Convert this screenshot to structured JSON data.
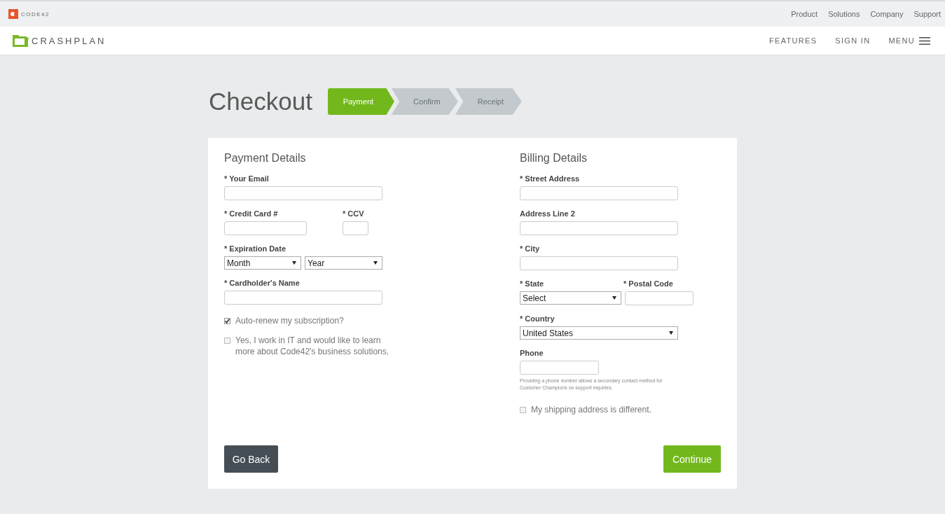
{
  "top_bar": {
    "brand": "CODE42",
    "links": [
      "Product",
      "Solutions",
      "Company",
      "Support"
    ]
  },
  "nav": {
    "brand": "CRASHPLAN",
    "links": [
      "FEATURES",
      "SIGN IN"
    ],
    "menu": "MENU"
  },
  "title": "Checkout",
  "steps": [
    {
      "label": "Payment",
      "selected": true
    },
    {
      "label": "Confirm",
      "selected": false
    },
    {
      "label": "Receipt",
      "selected": false
    }
  ],
  "payment": {
    "heading": "Payment Details",
    "email": {
      "label": "* Your Email"
    },
    "card_number": {
      "label": "* Credit Card #"
    },
    "ccv": {
      "label": "* CCV"
    },
    "expiration": {
      "label": "* Expiration Date",
      "month": "Month",
      "year": "Year"
    },
    "cardholder": {
      "label": "* Cardholder's Name"
    },
    "options": [
      {
        "label": "Auto-renew my subscription?",
        "checked": true
      },
      {
        "label": "Yes, I work in IT and would like to learn more about Code42's business solutions.",
        "checked": false
      }
    ]
  },
  "billing": {
    "heading": "Billing Details",
    "street": {
      "label": "* Street Address"
    },
    "line2": {
      "label": "Address Line 2"
    },
    "city": {
      "label": "* City"
    },
    "state": {
      "label": "* State",
      "value": "Select"
    },
    "postal": {
      "label": "* Postal Code"
    },
    "country": {
      "label": "* Country",
      "value": "United States"
    },
    "phone": {
      "label": "Phone",
      "hint": "Providing a phone number allows a secondary contact method for Customer Champions on support inquiries."
    },
    "shipping": {
      "label": "My shipping address is different.",
      "checked": false
    }
  },
  "buttons": {
    "back": "Go Back",
    "continue": "Continue"
  }
}
